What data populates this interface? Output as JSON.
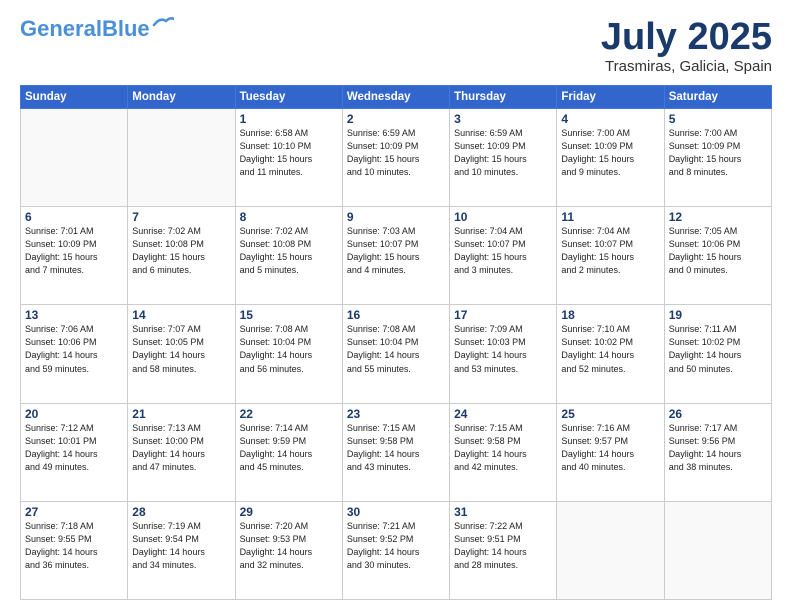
{
  "header": {
    "logo_line1": "General",
    "logo_line2": "Blue",
    "month": "July 2025",
    "location": "Trasmiras, Galicia, Spain"
  },
  "days_of_week": [
    "Sunday",
    "Monday",
    "Tuesday",
    "Wednesday",
    "Thursday",
    "Friday",
    "Saturday"
  ],
  "weeks": [
    [
      {
        "day": "",
        "info": ""
      },
      {
        "day": "",
        "info": ""
      },
      {
        "day": "1",
        "info": "Sunrise: 6:58 AM\nSunset: 10:10 PM\nDaylight: 15 hours\nand 11 minutes."
      },
      {
        "day": "2",
        "info": "Sunrise: 6:59 AM\nSunset: 10:09 PM\nDaylight: 15 hours\nand 10 minutes."
      },
      {
        "day": "3",
        "info": "Sunrise: 6:59 AM\nSunset: 10:09 PM\nDaylight: 15 hours\nand 10 minutes."
      },
      {
        "day": "4",
        "info": "Sunrise: 7:00 AM\nSunset: 10:09 PM\nDaylight: 15 hours\nand 9 minutes."
      },
      {
        "day": "5",
        "info": "Sunrise: 7:00 AM\nSunset: 10:09 PM\nDaylight: 15 hours\nand 8 minutes."
      }
    ],
    [
      {
        "day": "6",
        "info": "Sunrise: 7:01 AM\nSunset: 10:09 PM\nDaylight: 15 hours\nand 7 minutes."
      },
      {
        "day": "7",
        "info": "Sunrise: 7:02 AM\nSunset: 10:08 PM\nDaylight: 15 hours\nand 6 minutes."
      },
      {
        "day": "8",
        "info": "Sunrise: 7:02 AM\nSunset: 10:08 PM\nDaylight: 15 hours\nand 5 minutes."
      },
      {
        "day": "9",
        "info": "Sunrise: 7:03 AM\nSunset: 10:07 PM\nDaylight: 15 hours\nand 4 minutes."
      },
      {
        "day": "10",
        "info": "Sunrise: 7:04 AM\nSunset: 10:07 PM\nDaylight: 15 hours\nand 3 minutes."
      },
      {
        "day": "11",
        "info": "Sunrise: 7:04 AM\nSunset: 10:07 PM\nDaylight: 15 hours\nand 2 minutes."
      },
      {
        "day": "12",
        "info": "Sunrise: 7:05 AM\nSunset: 10:06 PM\nDaylight: 15 hours\nand 0 minutes."
      }
    ],
    [
      {
        "day": "13",
        "info": "Sunrise: 7:06 AM\nSunset: 10:06 PM\nDaylight: 14 hours\nand 59 minutes."
      },
      {
        "day": "14",
        "info": "Sunrise: 7:07 AM\nSunset: 10:05 PM\nDaylight: 14 hours\nand 58 minutes."
      },
      {
        "day": "15",
        "info": "Sunrise: 7:08 AM\nSunset: 10:04 PM\nDaylight: 14 hours\nand 56 minutes."
      },
      {
        "day": "16",
        "info": "Sunrise: 7:08 AM\nSunset: 10:04 PM\nDaylight: 14 hours\nand 55 minutes."
      },
      {
        "day": "17",
        "info": "Sunrise: 7:09 AM\nSunset: 10:03 PM\nDaylight: 14 hours\nand 53 minutes."
      },
      {
        "day": "18",
        "info": "Sunrise: 7:10 AM\nSunset: 10:02 PM\nDaylight: 14 hours\nand 52 minutes."
      },
      {
        "day": "19",
        "info": "Sunrise: 7:11 AM\nSunset: 10:02 PM\nDaylight: 14 hours\nand 50 minutes."
      }
    ],
    [
      {
        "day": "20",
        "info": "Sunrise: 7:12 AM\nSunset: 10:01 PM\nDaylight: 14 hours\nand 49 minutes."
      },
      {
        "day": "21",
        "info": "Sunrise: 7:13 AM\nSunset: 10:00 PM\nDaylight: 14 hours\nand 47 minutes."
      },
      {
        "day": "22",
        "info": "Sunrise: 7:14 AM\nSunset: 9:59 PM\nDaylight: 14 hours\nand 45 minutes."
      },
      {
        "day": "23",
        "info": "Sunrise: 7:15 AM\nSunset: 9:58 PM\nDaylight: 14 hours\nand 43 minutes."
      },
      {
        "day": "24",
        "info": "Sunrise: 7:15 AM\nSunset: 9:58 PM\nDaylight: 14 hours\nand 42 minutes."
      },
      {
        "day": "25",
        "info": "Sunrise: 7:16 AM\nSunset: 9:57 PM\nDaylight: 14 hours\nand 40 minutes."
      },
      {
        "day": "26",
        "info": "Sunrise: 7:17 AM\nSunset: 9:56 PM\nDaylight: 14 hours\nand 38 minutes."
      }
    ],
    [
      {
        "day": "27",
        "info": "Sunrise: 7:18 AM\nSunset: 9:55 PM\nDaylight: 14 hours\nand 36 minutes."
      },
      {
        "day": "28",
        "info": "Sunrise: 7:19 AM\nSunset: 9:54 PM\nDaylight: 14 hours\nand 34 minutes."
      },
      {
        "day": "29",
        "info": "Sunrise: 7:20 AM\nSunset: 9:53 PM\nDaylight: 14 hours\nand 32 minutes."
      },
      {
        "day": "30",
        "info": "Sunrise: 7:21 AM\nSunset: 9:52 PM\nDaylight: 14 hours\nand 30 minutes."
      },
      {
        "day": "31",
        "info": "Sunrise: 7:22 AM\nSunset: 9:51 PM\nDaylight: 14 hours\nand 28 minutes."
      },
      {
        "day": "",
        "info": ""
      },
      {
        "day": "",
        "info": ""
      }
    ]
  ]
}
